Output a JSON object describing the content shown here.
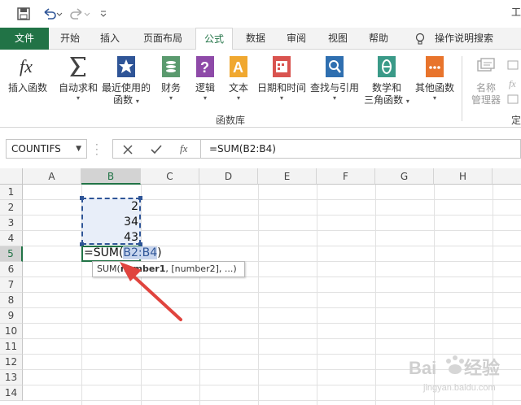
{
  "qat": {
    "icons": [
      "save-icon",
      "undo-icon",
      "redo-icon",
      "customize-icon"
    ],
    "cut_text": "工"
  },
  "tabs": [
    {
      "label": "文件",
      "active": false
    },
    {
      "label": "开始",
      "active": false
    },
    {
      "label": "插入",
      "active": false
    },
    {
      "label": "页面布局",
      "active": false
    },
    {
      "label": "公式",
      "active": true
    },
    {
      "label": "数据",
      "active": false
    },
    {
      "label": "审阅",
      "active": false
    },
    {
      "label": "视图",
      "active": false
    },
    {
      "label": "帮助",
      "active": false
    },
    {
      "label": "操作说明搜索",
      "active": false
    }
  ],
  "ribbon": {
    "buttons": [
      {
        "line1": "插入函数",
        "line2": "",
        "icon": "fx-icon"
      },
      {
        "line1": "自动求和",
        "line2": "",
        "icon": "sigma-icon"
      },
      {
        "line1": "最近使用的",
        "line2": "函数",
        "icon": "star-icon"
      },
      {
        "line1": "财务",
        "line2": "",
        "icon": "coins-icon"
      },
      {
        "line1": "逻辑",
        "line2": "",
        "icon": "question-icon"
      },
      {
        "line1": "文本",
        "line2": "",
        "icon": "text-a-icon"
      },
      {
        "line1": "日期和时间",
        "line2": "",
        "icon": "calendar-icon"
      },
      {
        "line1": "查找与引用",
        "line2": "",
        "icon": "magnifier-icon"
      },
      {
        "line1": "数学和",
        "line2": "三角函数",
        "icon": "theta-icon"
      },
      {
        "line1": "其他函数",
        "line2": "",
        "icon": "more-icon"
      },
      {
        "line1": "名称",
        "line2": "管理器",
        "icon": "name-manager-icon"
      }
    ],
    "group_label": "函数库",
    "cut_group_label": "定"
  },
  "formula_bar": {
    "name_box": "COUNTIFS",
    "fx_label": "fx",
    "formula": "=SUM(B2:B4)"
  },
  "grid": {
    "columns": [
      "A",
      "B",
      "C",
      "D",
      "E",
      "F",
      "G",
      "H"
    ],
    "rows": [
      "1",
      "2",
      "3",
      "4",
      "5",
      "6",
      "7",
      "8",
      "9",
      "10",
      "11",
      "12",
      "13",
      "14"
    ],
    "selected_column": "B",
    "selected_row": "5",
    "cells": {
      "B2": "2",
      "B3": "34",
      "B4": "43"
    },
    "editing_prefix": "=SUM(",
    "editing_ref": "B2:B4",
    "editing_suffix": ")"
  },
  "tooltip": {
    "func": "SUM(",
    "arg_bold": "number1",
    "rest": ", [number2], ...)"
  },
  "colors": {
    "excel_green": "#217346",
    "range_blue": "#2f5597",
    "arrow_red": "#e0443e"
  }
}
